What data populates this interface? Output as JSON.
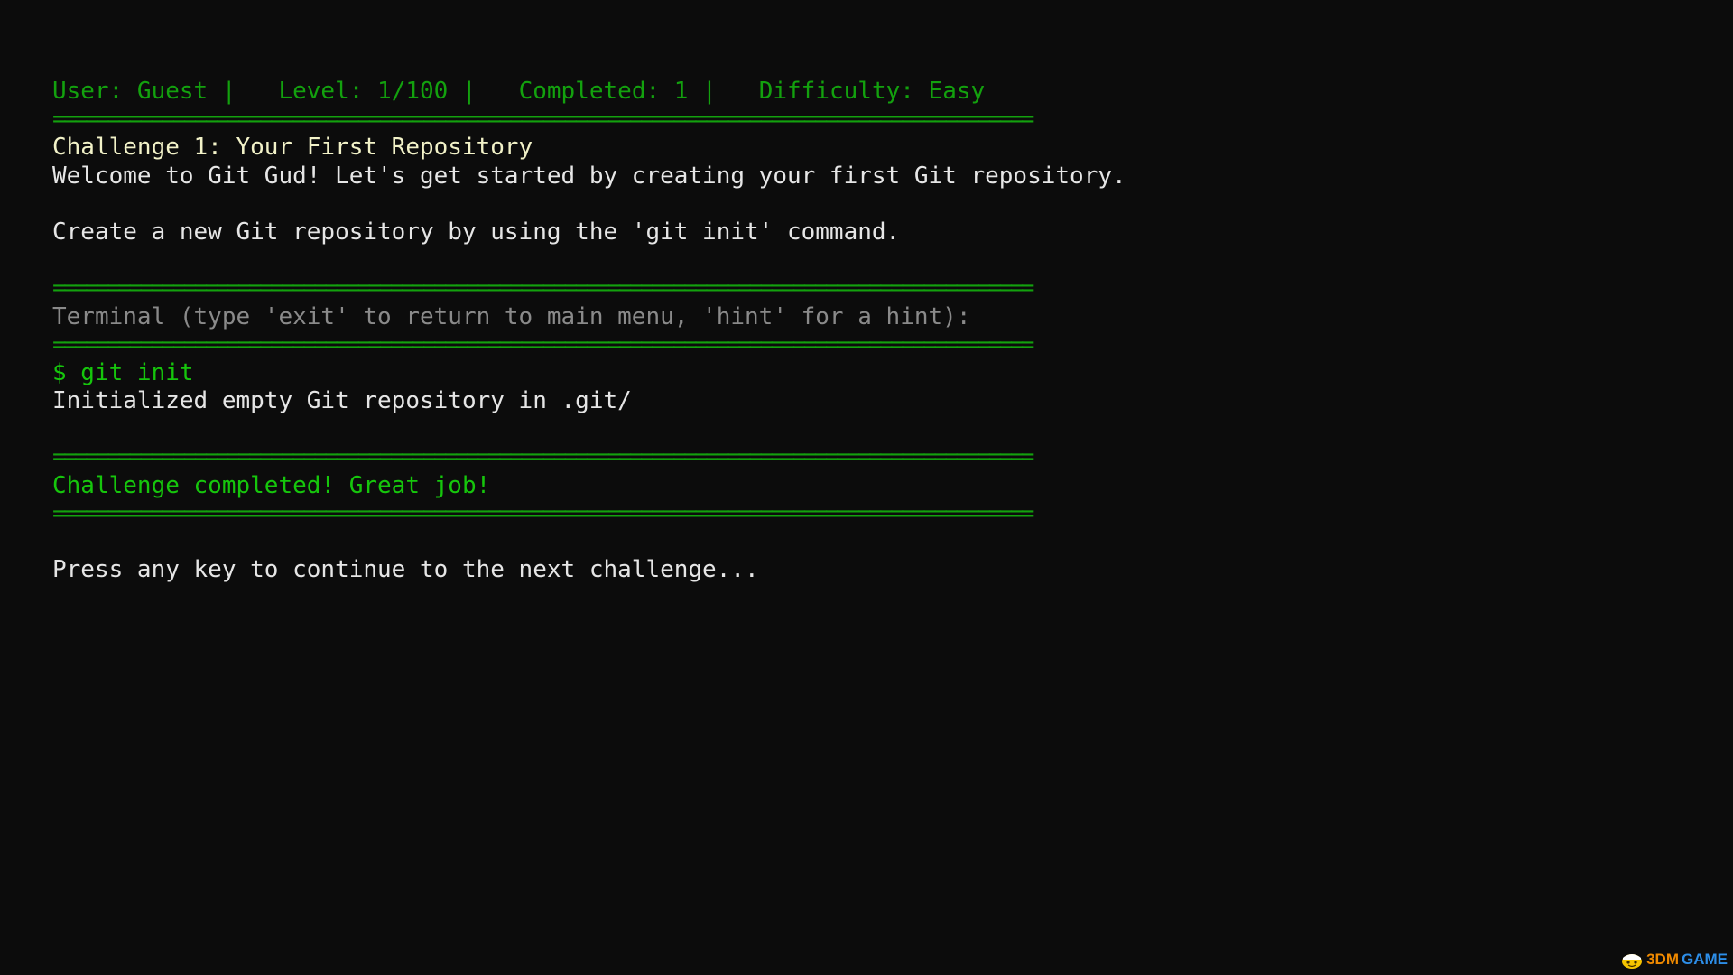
{
  "status_bar": {
    "user": "User: Guest",
    "level": "Level: 1/100",
    "completed": "Completed: 1",
    "difficulty": "Difficulty: Easy",
    "separator": "|"
  },
  "divider": "==========================================================================================",
  "challenge": {
    "title": "Challenge 1: Your First Repository",
    "welcome": "Welcome to Git Gud! Let's get started by creating your first Git repository.",
    "instruction": "Create a new Git repository by using the 'git init' command."
  },
  "terminal": {
    "header": "Terminal (type 'exit' to return to main menu, 'hint' for a hint):",
    "command": "$ git init",
    "output": "Initialized empty Git repository in .git/"
  },
  "result": {
    "message": "Challenge completed! Great job!",
    "continue_prompt": "Press any key to continue to the next challenge..."
  },
  "watermark": {
    "brand_a": "3DM",
    "brand_b": "GAME",
    "icon": "smiling-mascot-icon"
  },
  "colors": {
    "background": "#0c0c0c",
    "status_green": "#13a10e",
    "success_green": "#16c60c",
    "title_yellow": "#f2f2c8",
    "muted_gray": "#8a8a8a"
  }
}
